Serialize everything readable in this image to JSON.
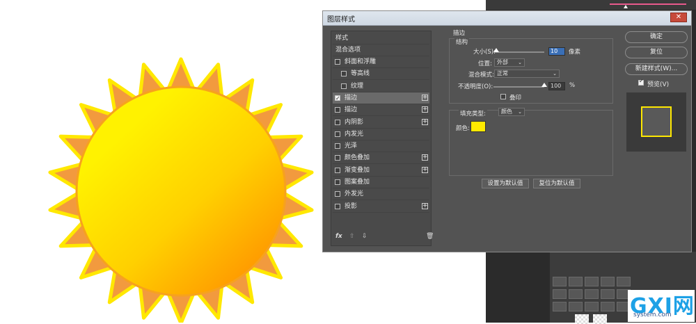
{
  "dialog": {
    "title": "图层样式",
    "close_icon": "close-icon"
  },
  "style_list": {
    "header_items": [
      "样式",
      "混合选项"
    ],
    "items": [
      {
        "label": "斜面和浮雕",
        "checked": false,
        "plus": false,
        "indent": false
      },
      {
        "label": "等高线",
        "checked": false,
        "plus": false,
        "indent": true
      },
      {
        "label": "纹理",
        "checked": false,
        "plus": false,
        "indent": true
      },
      {
        "label": "描边",
        "checked": true,
        "plus": true,
        "indent": false,
        "selected": true
      },
      {
        "label": "描边",
        "checked": false,
        "plus": true,
        "indent": false
      },
      {
        "label": "内阴影",
        "checked": false,
        "plus": true,
        "indent": false
      },
      {
        "label": "内发光",
        "checked": false,
        "plus": false,
        "indent": false
      },
      {
        "label": "光泽",
        "checked": false,
        "plus": false,
        "indent": false
      },
      {
        "label": "颜色叠加",
        "checked": false,
        "plus": true,
        "indent": false
      },
      {
        "label": "渐变叠加",
        "checked": false,
        "plus": true,
        "indent": false
      },
      {
        "label": "图案叠加",
        "checked": false,
        "plus": false,
        "indent": false
      },
      {
        "label": "外发光",
        "checked": false,
        "plus": false,
        "indent": false
      },
      {
        "label": "投影",
        "checked": false,
        "plus": true,
        "indent": false
      }
    ],
    "footer": {
      "fx": "fx",
      "up_icon": "arrow-up-icon",
      "down_icon": "arrow-down-icon",
      "trash_icon": "trash-icon"
    }
  },
  "stroke": {
    "section_title": "描边",
    "structure_title": "结构",
    "size_label": "大小(S):",
    "size_value": "10",
    "size_unit": "像素",
    "size_fraction": 0.05,
    "position_label": "位置:",
    "position_value": "外部",
    "blend_label": "混合模式:",
    "blend_value": "正常",
    "opacity_label": "不透明度(O):",
    "opacity_value": "100",
    "opacity_unit": "%",
    "opacity_fraction": 1.0,
    "overprint_label": "叠印",
    "fill_type_label": "填充类型:",
    "fill_type_value": "颜色",
    "color_label": "颜色:",
    "color_value": "#ffea00",
    "set_default": "设置为默认值",
    "reset_default": "复位为默认值"
  },
  "right_buttons": {
    "ok": "确定",
    "reset": "复位",
    "new_style": "新建样式(W)...",
    "preview_label": "预览(V)",
    "preview_checked": true
  },
  "colors": {
    "dialog_bg": "#535353",
    "sun_orange": "#f29a3e",
    "sun_yellow": "#ffe800",
    "preview_stroke": "#ffe800"
  },
  "watermark": {
    "logo": "GXI网",
    "site": "system.com"
  }
}
